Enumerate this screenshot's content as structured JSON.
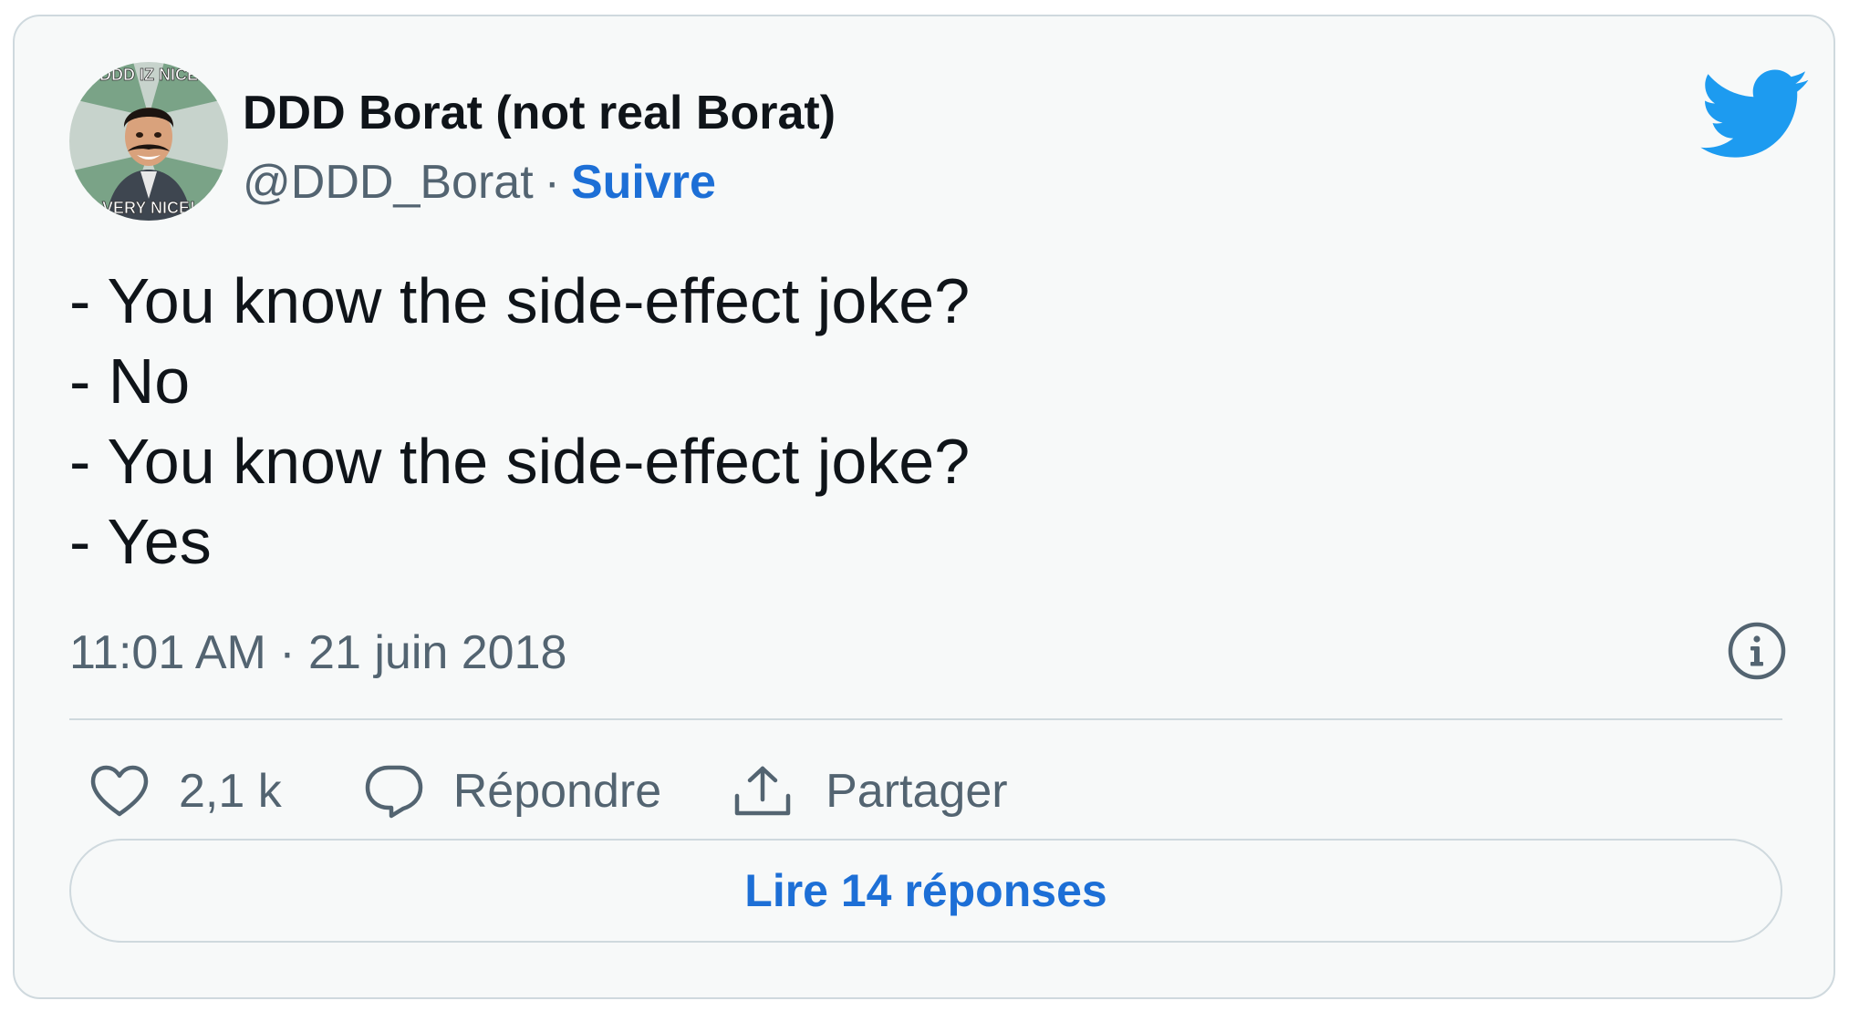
{
  "author": {
    "name": "DDD Borat (not real Borat)",
    "handle": "@DDD_Borat",
    "separator": "·",
    "follow_label": "Suivre",
    "avatar_icon": "borat-meme-avatar",
    "avatar_caption_top": "DDD IZ NICE",
    "avatar_caption_bottom": "VERY NICE!"
  },
  "tweet": {
    "lines": [
      "- You know the side-effect joke?",
      "- No",
      "- You know the side-effect joke?",
      "- Yes"
    ],
    "timestamp": "11:01 AM · 21 juin 2018"
  },
  "actions": {
    "likes_count": "2,1 k",
    "reply_label": "Répondre",
    "share_label": "Partager"
  },
  "read_replies_label": "Lire 14 réponses",
  "icons": {
    "brand": "twitter-bird-icon",
    "info": "info-icon",
    "like": "heart-icon",
    "reply": "reply-bubble-icon",
    "share": "share-icon"
  },
  "colors": {
    "brand_blue": "#1d9bf0",
    "link_blue": "#1d6fd6",
    "text_primary": "#0f1419",
    "text_secondary": "#536471",
    "card_background": "#f7f9f9",
    "border": "#cfd9de"
  }
}
